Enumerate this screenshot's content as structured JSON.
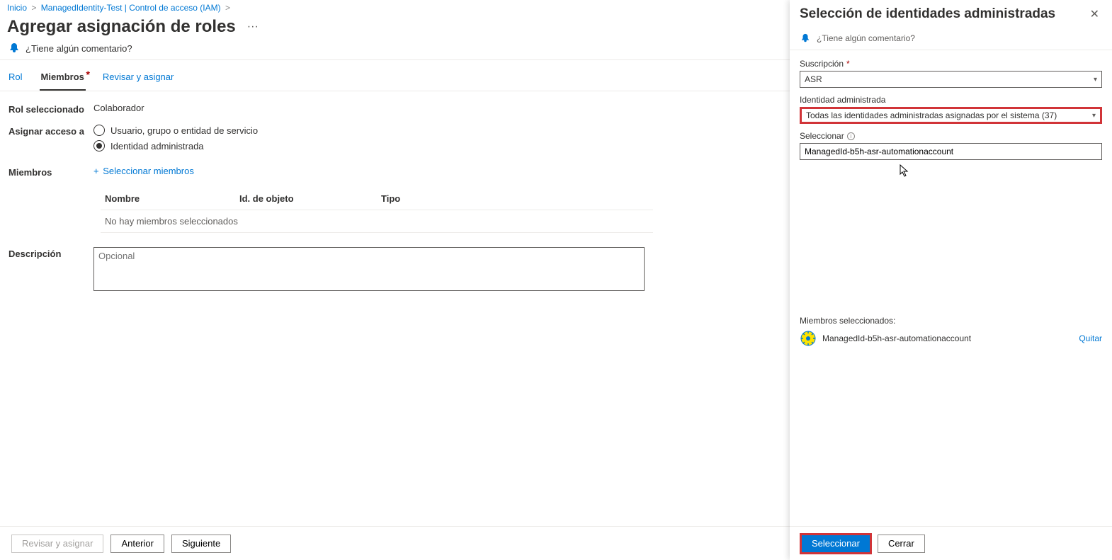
{
  "breadcrumb": {
    "home": "Inicio",
    "item": "ManagedIdentity-Test | Control de acceso (IAM)"
  },
  "page_title": "Agregar asignación de roles",
  "feedback_label": "¿Tiene algún comentario?",
  "tabs": {
    "role": "Rol",
    "members": "Miembros",
    "review": "Revisar y asignar"
  },
  "form": {
    "selected_role_label": "Rol seleccionado",
    "selected_role_value": "Colaborador",
    "assign_access_label": "Asignar acceso a",
    "radio_user": "Usuario, grupo o entidad de servicio",
    "radio_mi": "Identidad administrada",
    "members_label": "Miembros",
    "select_members_link": "Seleccionar miembros",
    "table": {
      "col_name": "Nombre",
      "col_objectid": "Id. de objeto",
      "col_type": "Tipo",
      "empty": "No hay miembros seleccionados"
    },
    "description_label": "Descripción",
    "description_placeholder": "Opcional"
  },
  "footer": {
    "review_assign": "Revisar y asignar",
    "prev": "Anterior",
    "next": "Siguiente"
  },
  "panel": {
    "title": "Selección de identidades administradas",
    "feedback": "¿Tiene algún comentario?",
    "subscription_label": "Suscripción",
    "subscription_value": "ASR",
    "mi_label": "Identidad administrada",
    "mi_value": "Todas las identidades administradas asignadas por el sistema (37)",
    "select_label": "Seleccionar",
    "select_value": "ManagedId-b5h-asr-automationaccount",
    "selected_members_label": "Miembros seleccionados:",
    "selected_member_name": "ManagedId-b5h-asr-automationaccount",
    "remove": "Quitar",
    "select_btn": "Seleccionar",
    "close_btn": "Cerrar"
  }
}
